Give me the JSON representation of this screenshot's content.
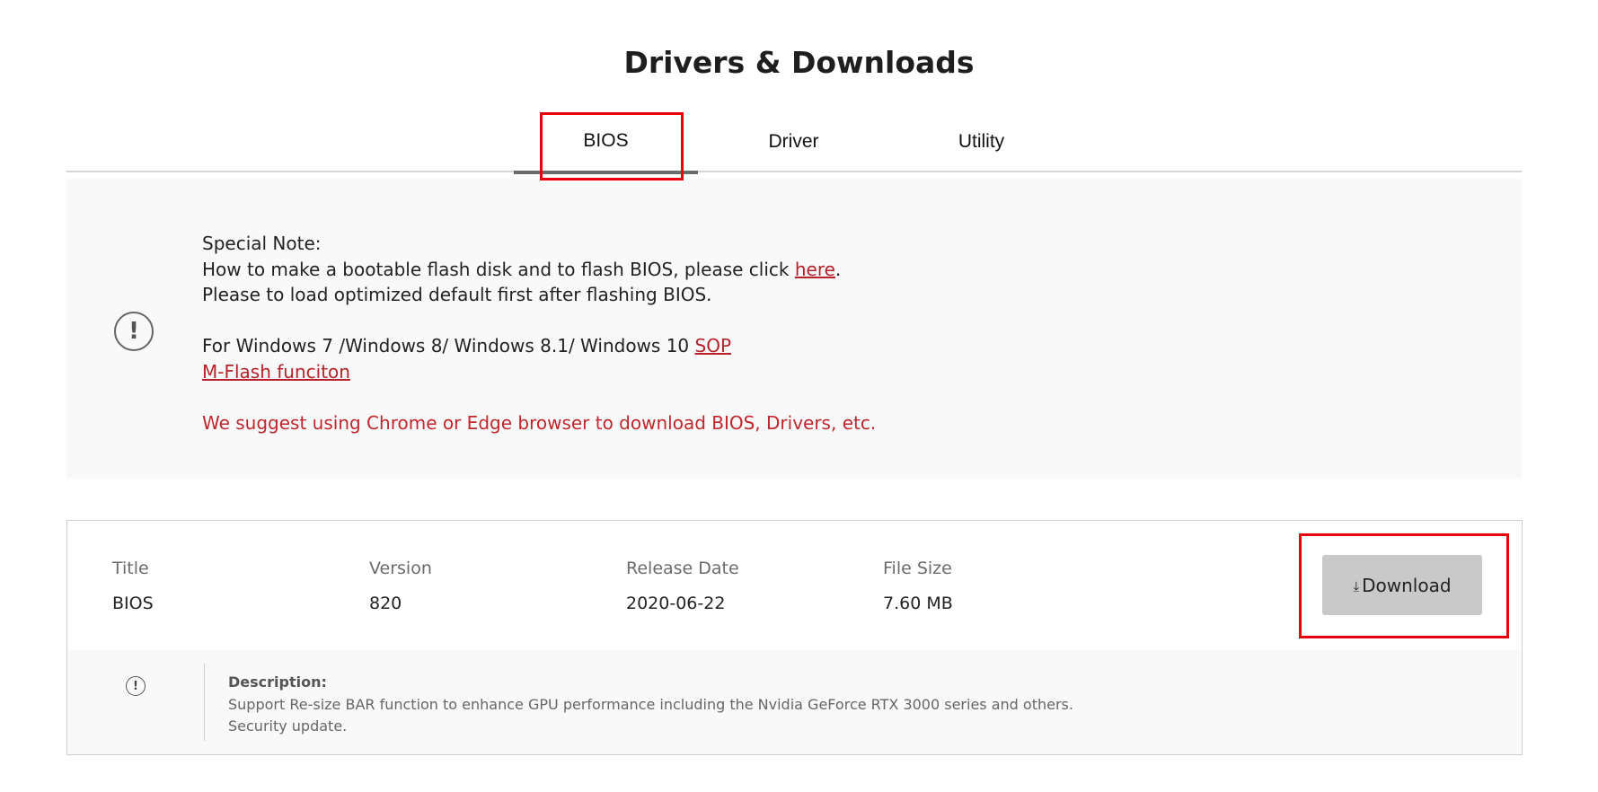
{
  "page": {
    "title": "Drivers & Downloads"
  },
  "tabs": [
    {
      "label": "BIOS",
      "active": true
    },
    {
      "label": "Driver",
      "active": false
    },
    {
      "label": "Utility",
      "active": false
    }
  ],
  "note": {
    "icon": "exclamation-circle-icon",
    "heading": "Special Note:",
    "line1_text": "How to make a bootable flash disk and to flash BIOS, please click ",
    "line1_link": "here",
    "line1_end": ".",
    "line2": "Please to load optimized default first after flashing BIOS.",
    "line3_text": "For Windows 7 /Windows 8/ Windows 8.1/ Windows 10 ",
    "line3_link": "SOP",
    "line4_link": "M-Flash funciton",
    "warning": "We suggest using Chrome or Edge browser to download BIOS, Drivers, etc."
  },
  "file": {
    "columns": [
      "Title",
      "Version",
      "Release Date",
      "File Size"
    ],
    "values": [
      "BIOS",
      "820",
      "2020-06-22",
      "7.60 MB"
    ],
    "download_label": "Download",
    "download_icon": "download-arrow-icon",
    "description_label": "Description:",
    "description_lines": [
      "Support Re-size BAR function to enhance GPU performance including the Nvidia GeForce RTX 3000 series and others.",
      "Security update."
    ]
  },
  "colors": {
    "accent_link": "#b8202a",
    "highlight": "#e8000b",
    "button_bg": "#c9c9c9"
  }
}
